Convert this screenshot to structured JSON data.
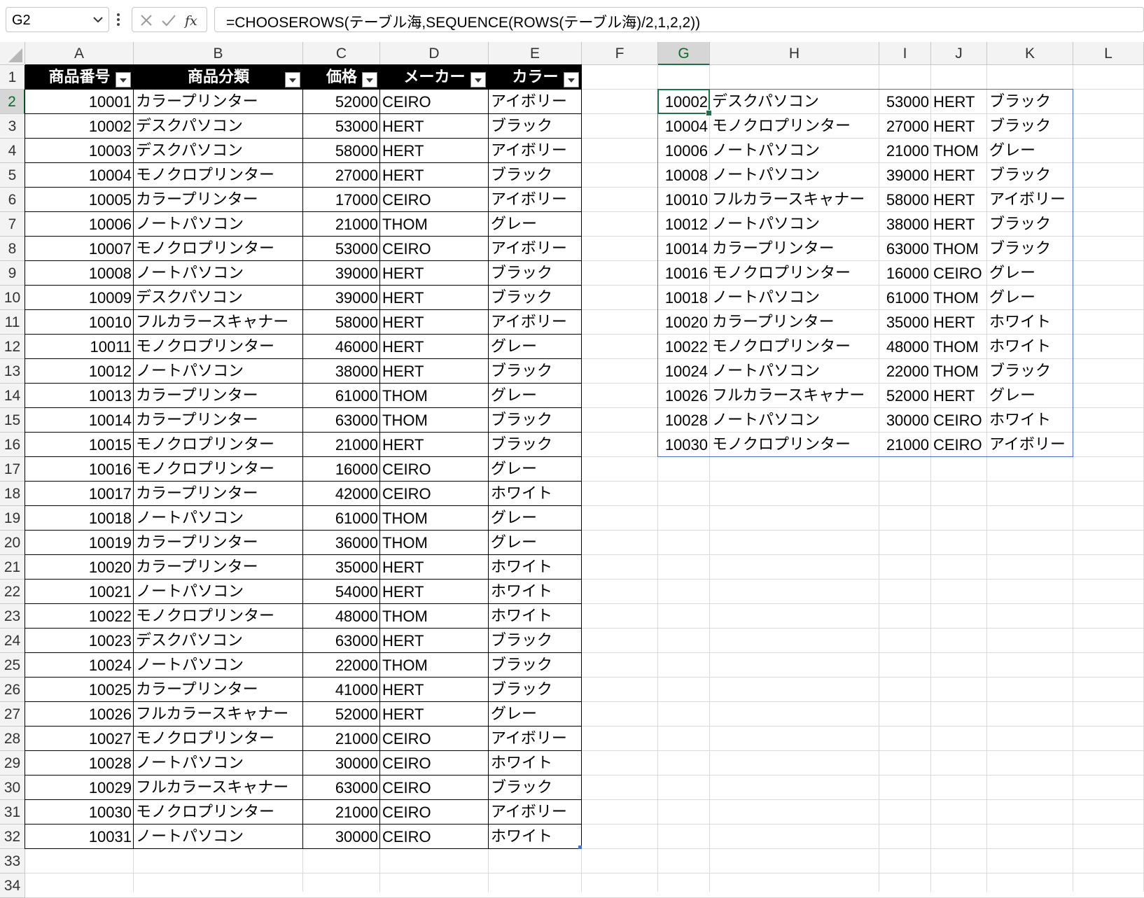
{
  "name_box": "G2",
  "formula": "=CHOOSEROWS(テーブル海,SEQUENCE(ROWS(テーブル海)/2,1,2,2))",
  "columns": [
    "A",
    "B",
    "C",
    "D",
    "E",
    "F",
    "G",
    "H",
    "I",
    "J",
    "K",
    "L"
  ],
  "selected_column": "G",
  "selected_row": "2",
  "rows": [
    "1",
    "2",
    "3",
    "4",
    "5",
    "6",
    "7",
    "8",
    "9",
    "10",
    "11",
    "12",
    "13",
    "14",
    "15",
    "16",
    "17",
    "18",
    "19",
    "20",
    "21",
    "22",
    "23",
    "24",
    "25",
    "26",
    "27",
    "28",
    "29",
    "30",
    "31",
    "32",
    "33",
    "34"
  ],
  "table": {
    "headers": [
      "商品番号",
      "商品分類",
      "価格",
      "メーカー",
      "カラー"
    ],
    "rows": [
      [
        "10001",
        "カラープリンター",
        "52000",
        "CEIRO",
        "アイボリー"
      ],
      [
        "10002",
        "デスクパソコン",
        "53000",
        "HERT",
        "ブラック"
      ],
      [
        "10003",
        "デスクパソコン",
        "58000",
        "HERT",
        "アイボリー"
      ],
      [
        "10004",
        "モノクロプリンター",
        "27000",
        "HERT",
        "ブラック"
      ],
      [
        "10005",
        "カラープリンター",
        "17000",
        "CEIRO",
        "アイボリー"
      ],
      [
        "10006",
        "ノートパソコン",
        "21000",
        "THOM",
        "グレー"
      ],
      [
        "10007",
        "モノクロプリンター",
        "53000",
        "CEIRO",
        "アイボリー"
      ],
      [
        "10008",
        "ノートパソコン",
        "39000",
        "HERT",
        "ブラック"
      ],
      [
        "10009",
        "デスクパソコン",
        "39000",
        "HERT",
        "ブラック"
      ],
      [
        "10010",
        "フルカラースキャナー",
        "58000",
        "HERT",
        "アイボリー"
      ],
      [
        "10011",
        "モノクロプリンター",
        "46000",
        "HERT",
        "グレー"
      ],
      [
        "10012",
        "ノートパソコン",
        "38000",
        "HERT",
        "ブラック"
      ],
      [
        "10013",
        "カラープリンター",
        "61000",
        "THOM",
        "グレー"
      ],
      [
        "10014",
        "カラープリンター",
        "63000",
        "THOM",
        "ブラック"
      ],
      [
        "10015",
        "モノクロプリンター",
        "21000",
        "HERT",
        "ブラック"
      ],
      [
        "10016",
        "モノクロプリンター",
        "16000",
        "CEIRO",
        "グレー"
      ],
      [
        "10017",
        "カラープリンター",
        "42000",
        "CEIRO",
        "ホワイト"
      ],
      [
        "10018",
        "ノートパソコン",
        "61000",
        "THOM",
        "グレー"
      ],
      [
        "10019",
        "カラープリンター",
        "36000",
        "THOM",
        "グレー"
      ],
      [
        "10020",
        "カラープリンター",
        "35000",
        "HERT",
        "ホワイト"
      ],
      [
        "10021",
        "ノートパソコン",
        "54000",
        "HERT",
        "ホワイト"
      ],
      [
        "10022",
        "モノクロプリンター",
        "48000",
        "THOM",
        "ホワイト"
      ],
      [
        "10023",
        "デスクパソコン",
        "63000",
        "HERT",
        "ブラック"
      ],
      [
        "10024",
        "ノートパソコン",
        "22000",
        "THOM",
        "ブラック"
      ],
      [
        "10025",
        "カラープリンター",
        "41000",
        "HERT",
        "ブラック"
      ],
      [
        "10026",
        "フルカラースキャナー",
        "52000",
        "HERT",
        "グレー"
      ],
      [
        "10027",
        "モノクロプリンター",
        "21000",
        "CEIRO",
        "アイボリー"
      ],
      [
        "10028",
        "ノートパソコン",
        "30000",
        "CEIRO",
        "ホワイト"
      ],
      [
        "10029",
        "フルカラースキャナー",
        "63000",
        "CEIRO",
        "ブラック"
      ],
      [
        "10030",
        "モノクロプリンター",
        "21000",
        "CEIRO",
        "アイボリー"
      ],
      [
        "10031",
        "ノートパソコン",
        "30000",
        "CEIRO",
        "ホワイト"
      ]
    ]
  },
  "spill": [
    [
      "10002",
      "デスクパソコン",
      "53000",
      "HERT",
      "ブラック"
    ],
    [
      "10004",
      "モノクロプリンター",
      "27000",
      "HERT",
      "ブラック"
    ],
    [
      "10006",
      "ノートパソコン",
      "21000",
      "THOM",
      "グレー"
    ],
    [
      "10008",
      "ノートパソコン",
      "39000",
      "HERT",
      "ブラック"
    ],
    [
      "10010",
      "フルカラースキャナー",
      "58000",
      "HERT",
      "アイボリー"
    ],
    [
      "10012",
      "ノートパソコン",
      "38000",
      "HERT",
      "ブラック"
    ],
    [
      "10014",
      "カラープリンター",
      "63000",
      "THOM",
      "ブラック"
    ],
    [
      "10016",
      "モノクロプリンター",
      "16000",
      "CEIRO",
      "グレー"
    ],
    [
      "10018",
      "ノートパソコン",
      "61000",
      "THOM",
      "グレー"
    ],
    [
      "10020",
      "カラープリンター",
      "35000",
      "HERT",
      "ホワイト"
    ],
    [
      "10022",
      "モノクロプリンター",
      "48000",
      "THOM",
      "ホワイト"
    ],
    [
      "10024",
      "ノートパソコン",
      "22000",
      "THOM",
      "ブラック"
    ],
    [
      "10026",
      "フルカラースキャナー",
      "52000",
      "HERT",
      "グレー"
    ],
    [
      "10028",
      "ノートパソコン",
      "30000",
      "CEIRO",
      "ホワイト"
    ],
    [
      "10030",
      "モノクロプリンター",
      "21000",
      "CEIRO",
      "アイボリー"
    ]
  ],
  "icons": {
    "name_box_dropdown": "chevron-down-icon",
    "more": "vertical-dots-icon",
    "cancel": "close-icon",
    "enter": "check-icon",
    "function": "fx-icon"
  },
  "colors": {
    "accent": "#217346",
    "spill_border": "#4a72c2",
    "table_header_bg": "#000000",
    "header_bg": "#f3f3f3"
  }
}
